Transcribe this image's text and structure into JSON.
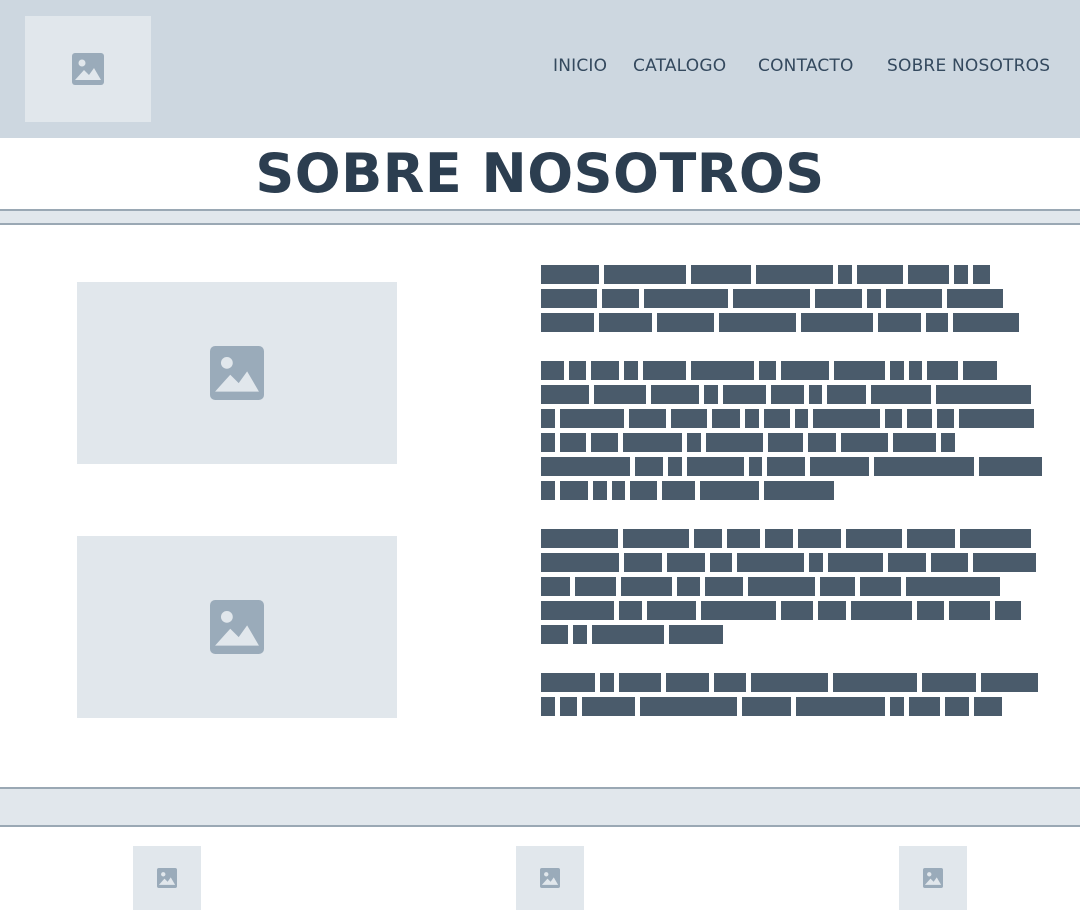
{
  "header": {
    "logo_icon": "image-placeholder-icon",
    "nav": {
      "inicio": "INICIO",
      "catalogo": "CATALOGO",
      "contacto": "CONTACTO",
      "sobre_nosotros": "SOBRE NOSOTROS"
    }
  },
  "page": {
    "title": "SOBRE NOSOTROS"
  },
  "content": {
    "images": [
      "image-placeholder-icon",
      "image-placeholder-icon"
    ]
  },
  "footer": {
    "icons": [
      "image-placeholder-icon",
      "image-placeholder-icon",
      "image-placeholder-icon"
    ]
  },
  "colors": {
    "header_bg": "#cdd7e0",
    "placeholder_bg": "#e1e7ec",
    "placeholder_icon": "#9aabba",
    "redacted_text": "#4a5b6b",
    "title_text": "#2c3e50"
  }
}
